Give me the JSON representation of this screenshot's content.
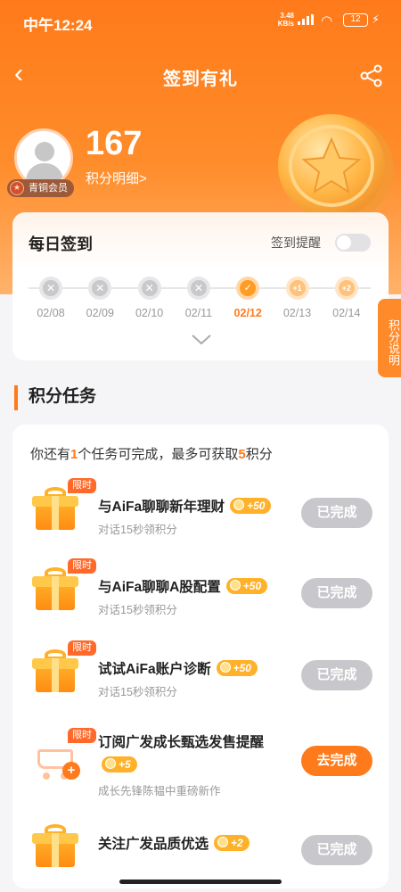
{
  "status_bar": {
    "time": "中午12:24",
    "net_speed": "3.48",
    "net_unit": "KB/s",
    "battery": "12"
  },
  "nav": {
    "title": "签到有礼"
  },
  "profile": {
    "points": "167",
    "points_detail": "积分明细>",
    "member_level": "青铜会员"
  },
  "daily_sign": {
    "title": "每日签到",
    "remind_label": "签到提醒",
    "remind_on": false,
    "days": [
      {
        "date": "02/08",
        "state": "missed",
        "mark": "✕"
      },
      {
        "date": "02/09",
        "state": "missed",
        "mark": "✕"
      },
      {
        "date": "02/10",
        "state": "missed",
        "mark": "✕"
      },
      {
        "date": "02/11",
        "state": "missed",
        "mark": "✕"
      },
      {
        "date": "02/12",
        "state": "done",
        "mark": "✓"
      },
      {
        "date": "02/13",
        "state": "future",
        "mark": "+1"
      },
      {
        "date": "02/14",
        "state": "future",
        "mark": "+2"
      }
    ]
  },
  "side_tab": "积分说明",
  "tasks_section": {
    "title": "积分任务",
    "summary": {
      "pre": "你还有",
      "count": "1",
      "mid": "个任务可完成，最多可获取",
      "max": "5",
      "post": "积分"
    },
    "tasks": [
      {
        "tag": "限时",
        "name": "与AiFa聊聊新年理财",
        "points": "+50",
        "desc": "对话15秒领积分",
        "button": "已完成",
        "status": "done",
        "icon": "gift-icon"
      },
      {
        "tag": "限时",
        "name": "与AiFa聊聊A股配置",
        "points": "+50",
        "desc": "对话15秒领积分",
        "button": "已完成",
        "status": "done",
        "icon": "gift-icon"
      },
      {
        "tag": "限时",
        "name": "试试AiFa账户诊断",
        "points": "+50",
        "desc": "对话15秒领积分",
        "button": "已完成",
        "status": "done",
        "icon": "gift-icon"
      },
      {
        "tag": "限时",
        "name": "订阅广发成长甄选发售提醒",
        "points": "+5",
        "desc": "成长先锋陈韫中重磅新作",
        "button": "去完成",
        "status": "todo",
        "icon": "cart-icon"
      },
      {
        "tag": "",
        "name": "关注广发品质优选",
        "points": "+2",
        "desc": "",
        "button": "已完成",
        "status": "done",
        "icon": "gift-icon"
      }
    ]
  },
  "colors": {
    "brand": "#ff7a1a",
    "done_button": "#c8c8cc",
    "go_button": "#ff7a1a"
  }
}
